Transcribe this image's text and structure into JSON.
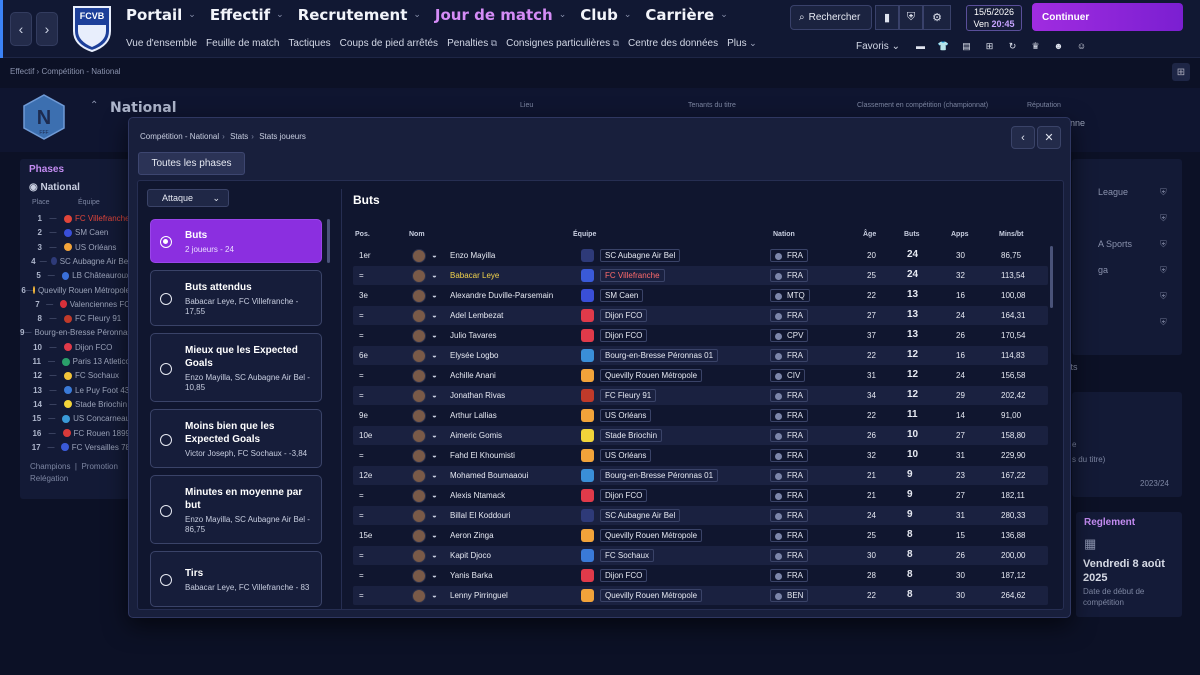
{
  "topnav": {
    "items": [
      {
        "label": "Portail",
        "active": false
      },
      {
        "label": "Effectif",
        "active": false
      },
      {
        "label": "Recrutement",
        "active": false
      },
      {
        "label": "Jour de match",
        "active": true
      },
      {
        "label": "Club",
        "active": false
      },
      {
        "label": "Carrière",
        "active": false
      }
    ],
    "subnav": [
      "Vue d'ensemble",
      "Feuille de match",
      "Tactiques",
      "Coups de pied arrêtés",
      "Penalties",
      "Consignes particulières",
      "Centre des données",
      "Plus"
    ],
    "club_crest_text": "FCVB",
    "search_label": "Rechercher",
    "date": "15/5/2026",
    "day": "Ven",
    "time": "20:45",
    "continue_label": "Continuer",
    "favoris_label": "Favoris"
  },
  "background": {
    "breadcrumb": [
      "Effectif",
      "Compétition - National"
    ],
    "competition_name": "National",
    "competition_logo_letter": "N",
    "competition_logo_sub": "FFF",
    "fields": [
      "Lieu",
      "Tenants du titre",
      "Classement en compétition (championnat)",
      "Réputation"
    ],
    "onne_text": "onne",
    "phases_title": "Phases",
    "phases_comp": "National",
    "phases_headers": [
      "Place",
      "Équipe"
    ],
    "standings": [
      {
        "pos": "1",
        "team": "FC Villefranche",
        "color": "#e0453a",
        "hl": true
      },
      {
        "pos": "2",
        "team": "SM Caen",
        "color": "#3a4fd8"
      },
      {
        "pos": "3",
        "team": "US Orléans",
        "color": "#f2a33a"
      },
      {
        "pos": "4",
        "team": "SC Aubagne Air Bel",
        "color": "#2e3a78"
      },
      {
        "pos": "5",
        "team": "LB Châteauroux",
        "color": "#3a6fd8"
      },
      {
        "pos": "6",
        "team": "Quevilly Rouen Métropole",
        "color": "#f2b63a"
      },
      {
        "pos": "7",
        "team": "Valenciennes FC",
        "color": "#d8303a"
      },
      {
        "pos": "8",
        "team": "FC Fleury 91",
        "color": "#c03a2a"
      },
      {
        "pos": "9",
        "team": "Bourg-en-Bresse Péronnas 01",
        "color": "#3a8fd8"
      },
      {
        "pos": "10",
        "team": "Dijon FCO",
        "color": "#e03a4a"
      },
      {
        "pos": "11",
        "team": "Paris 13 Atletico",
        "color": "#2aa06a"
      },
      {
        "pos": "12",
        "team": "FC Sochaux",
        "color": "#f2c43a"
      },
      {
        "pos": "13",
        "team": "Le Puy Foot 43",
        "color": "#3a7ad8"
      },
      {
        "pos": "14",
        "team": "Stade Briochin",
        "color": "#f2d43a"
      },
      {
        "pos": "15",
        "team": "US Concarneau",
        "color": "#3a9ad8"
      },
      {
        "pos": "16",
        "team": "FC Rouen 1899",
        "color": "#d83a3a"
      },
      {
        "pos": "17",
        "team": "FC Versailles 78",
        "color": "#3a5ad8"
      }
    ],
    "legend": [
      "Champions",
      "Promotion",
      "Relégation"
    ],
    "right_items": [
      "League",
      "",
      "A Sports",
      "ga",
      "",
      ""
    ],
    "right_bottom": "mpionnats",
    "right2_lines": [
      "e",
      "s du titre)",
      "2023/24"
    ],
    "reglement_title": "Reglement",
    "reglement_date": "Vendredi 8 août 2025",
    "reglement_sub": "Date de début de compétition"
  },
  "modal": {
    "breadcrumb": [
      "Compétition - National",
      "Stats",
      "Stats joueurs"
    ],
    "all_phases_label": "Toutes les phases",
    "filter_label": "Attaque",
    "categories": [
      {
        "title": "Buts",
        "sub": "2 joueurs - 24",
        "selected": true
      },
      {
        "title": "Buts attendus",
        "sub": "Babacar Leye, FC Villefranche - 17,55",
        "selected": false
      },
      {
        "title": "Mieux que les Expected Goals",
        "sub": "Enzo Mayilla, SC Aubagne Air Bel - 10,85",
        "selected": false
      },
      {
        "title": "Moins bien que les Expected Goals",
        "sub": "Victor Joseph, FC Sochaux - -3,84",
        "selected": false
      },
      {
        "title": "Minutes en moyenne par but",
        "sub": "Enzo Mayilla, SC Aubagne Air Bel - 86,75",
        "selected": false
      },
      {
        "title": "Tirs",
        "sub": "Babacar Leye, FC Villefranche - 83",
        "selected": false
      }
    ],
    "table_title": "Buts",
    "columns": [
      "Pos.",
      "Nom",
      "Équipe",
      "Nation",
      "Âge",
      "Buts",
      "Apps",
      "Mins/bt"
    ],
    "rows": [
      {
        "pos": "1er",
        "name": "Enzo Mayilla",
        "team": "SC Aubagne Air Bel",
        "nation": "FRA",
        "age": "20",
        "goals": "24",
        "apps": "30",
        "mins": "86,75",
        "tcolor": "#2e3a78"
      },
      {
        "pos": "=",
        "name": "Babacar Leye",
        "team": "FC Villefranche",
        "nation": "FRA",
        "age": "25",
        "goals": "24",
        "apps": "32",
        "mins": "113,54",
        "tcolor": "#3a5ad8",
        "highlight": true
      },
      {
        "pos": "3e",
        "name": "Alexandre Duville-Parsemain",
        "team": "SM Caen",
        "nation": "MTQ",
        "age": "22",
        "goals": "13",
        "apps": "16",
        "mins": "100,08",
        "tcolor": "#3a4fd8"
      },
      {
        "pos": "=",
        "name": "Adel Lembezat",
        "team": "Dijon FCO",
        "nation": "FRA",
        "age": "27",
        "goals": "13",
        "apps": "24",
        "mins": "164,31",
        "tcolor": "#e03a4a"
      },
      {
        "pos": "=",
        "name": "Julio Tavares",
        "team": "Dijon FCO",
        "nation": "CPV",
        "age": "37",
        "goals": "13",
        "apps": "26",
        "mins": "170,54",
        "tcolor": "#e03a4a"
      },
      {
        "pos": "6e",
        "name": "Elysée Logbo",
        "team": "Bourg-en-Bresse Péronnas 01",
        "nation": "FRA",
        "age": "22",
        "goals": "12",
        "apps": "16",
        "mins": "114,83",
        "tcolor": "#3a8fd8"
      },
      {
        "pos": "=",
        "name": "Achille Anani",
        "team": "Quevilly Rouen Métropole",
        "nation": "CIV",
        "age": "31",
        "goals": "12",
        "apps": "24",
        "mins": "156,58",
        "tcolor": "#f2a33a"
      },
      {
        "pos": "=",
        "name": "Jonathan Rivas",
        "team": "FC Fleury 91",
        "nation": "FRA",
        "age": "34",
        "goals": "12",
        "apps": "29",
        "mins": "202,42",
        "tcolor": "#c03a2a"
      },
      {
        "pos": "9e",
        "name": "Arthur Lallias",
        "team": "US Orléans",
        "nation": "FRA",
        "age": "22",
        "goals": "11",
        "apps": "14",
        "mins": "91,00",
        "tcolor": "#f2a33a"
      },
      {
        "pos": "10e",
        "name": "Aimeric Gomis",
        "team": "Stade Briochin",
        "nation": "FRA",
        "age": "26",
        "goals": "10",
        "apps": "27",
        "mins": "158,80",
        "tcolor": "#f2d43a"
      },
      {
        "pos": "=",
        "name": "Fahd El Khoumisti",
        "team": "US Orléans",
        "nation": "FRA",
        "age": "32",
        "goals": "10",
        "apps": "31",
        "mins": "229,90",
        "tcolor": "#f2a33a"
      },
      {
        "pos": "12e",
        "name": "Mohamed Boumaaoui",
        "team": "Bourg-en-Bresse Péronnas 01",
        "nation": "FRA",
        "age": "21",
        "goals": "9",
        "apps": "23",
        "mins": "167,22",
        "tcolor": "#3a8fd8"
      },
      {
        "pos": "=",
        "name": "Alexis Ntamack",
        "team": "Dijon FCO",
        "nation": "FRA",
        "age": "21",
        "goals": "9",
        "apps": "27",
        "mins": "182,11",
        "tcolor": "#e03a4a"
      },
      {
        "pos": "=",
        "name": "Billal El Koddouri",
        "team": "SC Aubagne Air Bel",
        "nation": "FRA",
        "age": "24",
        "goals": "9",
        "apps": "31",
        "mins": "280,33",
        "tcolor": "#2e3a78"
      },
      {
        "pos": "15e",
        "name": "Aeron Zinga",
        "team": "Quevilly Rouen Métropole",
        "nation": "FRA",
        "age": "25",
        "goals": "8",
        "apps": "15",
        "mins": "136,88",
        "tcolor": "#f2a33a"
      },
      {
        "pos": "=",
        "name": "Kapit Djoco",
        "team": "FC Sochaux",
        "nation": "FRA",
        "age": "30",
        "goals": "8",
        "apps": "26",
        "mins": "200,00",
        "tcolor": "#3a7ad8"
      },
      {
        "pos": "=",
        "name": "Yanis Barka",
        "team": "Dijon FCO",
        "nation": "FRA",
        "age": "28",
        "goals": "8",
        "apps": "30",
        "mins": "187,12",
        "tcolor": "#e03a4a"
      },
      {
        "pos": "=",
        "name": "Lenny Pirringuel",
        "team": "Quevilly Rouen Métropole",
        "nation": "BEN",
        "age": "22",
        "goals": "8",
        "apps": "30",
        "mins": "264,62",
        "tcolor": "#f2a33a"
      }
    ]
  }
}
